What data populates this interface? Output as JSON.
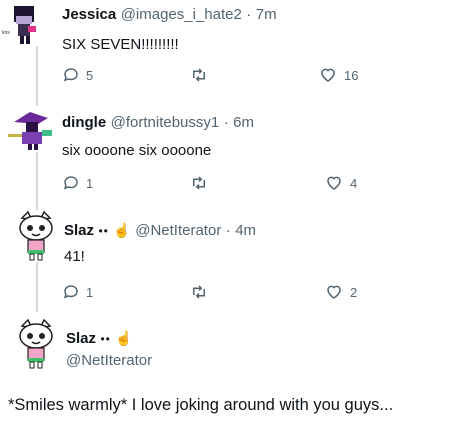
{
  "tweets": [
    {
      "name": "Jessica",
      "handle": "@images_i_hate2",
      "sep": "·",
      "time": "7m",
      "text": "SIX SEVEN!!!!!!!!!",
      "replies": "5",
      "retweets": "",
      "likes": "16"
    },
    {
      "name": "dingle",
      "handle": "@fortnitebussy1",
      "sep": "·",
      "time": "6m",
      "text": "six oooone six oooone",
      "replies": "1",
      "retweets": "",
      "likes": "4"
    },
    {
      "name": "Slaz",
      "dots": "••",
      "hand": "☝",
      "handle": "@NetIterator",
      "sep": "·",
      "time": "4m",
      "text": "41!",
      "replies": "1",
      "retweets": "",
      "likes": "2"
    }
  ],
  "composer": {
    "name": "Slaz",
    "dots": "••",
    "hand": "☝",
    "handle": "@NetIterator",
    "text": "*Smiles warmly* I love joking around with you guys..."
  },
  "icons": {
    "reply": "reply-icon",
    "retweet": "retweet-icon",
    "like": "heart-icon"
  },
  "colors": {
    "text": "#0f1419",
    "muted": "#536471",
    "line": "#cfd9de"
  }
}
